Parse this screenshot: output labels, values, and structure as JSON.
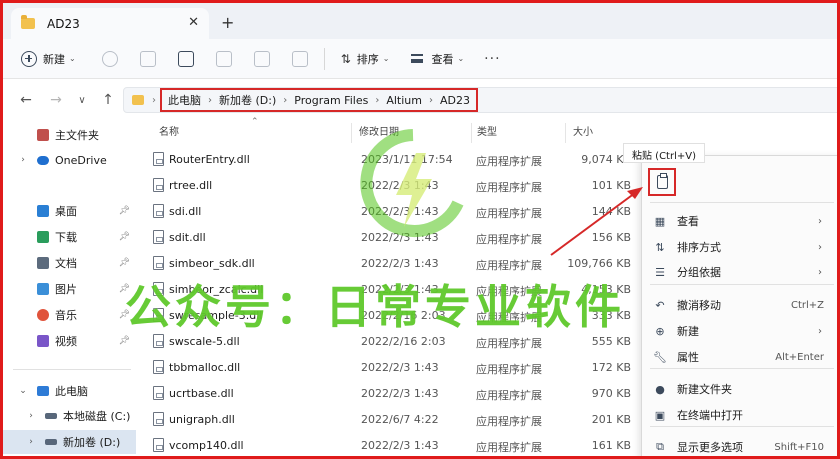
{
  "window": {
    "tab_title": "AD23",
    "tab_close": "✕",
    "new_tab": "+"
  },
  "toolbar": {
    "new_label": "新建",
    "sort_label": "排序",
    "view_label": "查看",
    "more": "···"
  },
  "navigation": {
    "back": "←",
    "forward": "→",
    "recent": "∨",
    "up": "↑",
    "breadcrumbs": [
      "此电脑",
      "新加卷 (D:)",
      "Program Files",
      "Altium",
      "AD23"
    ]
  },
  "sidebar": {
    "items": [
      {
        "label": "主文件夹",
        "icon": "home-icon",
        "color": "#c0504d"
      },
      {
        "label": "OneDrive",
        "icon": "cloud-icon",
        "color": "#1f6fcf"
      },
      {
        "label": "桌面",
        "icon": "desktop-icon",
        "color": "#2a7fd4"
      },
      {
        "label": "下载",
        "icon": "download-icon",
        "color": "#2a9d5c"
      },
      {
        "label": "文档",
        "icon": "document-icon",
        "color": "#5c6b7d"
      },
      {
        "label": "图片",
        "icon": "pictures-icon",
        "color": "#3b8fd8"
      },
      {
        "label": "音乐",
        "icon": "music-icon",
        "color": "#e0533b"
      },
      {
        "label": "视频",
        "icon": "video-icon",
        "color": "#7a56c8"
      },
      {
        "label": "此电脑",
        "icon": "computer-icon",
        "color": "#2e7bd6"
      },
      {
        "label": "本地磁盘 (C:)",
        "icon": "drive-icon",
        "color": "#58677a"
      },
      {
        "label": "新加卷 (D:)",
        "icon": "drive-icon",
        "color": "#58677a"
      }
    ]
  },
  "columns": {
    "name": "名称",
    "modified": "修改日期",
    "type": "类型",
    "size": "大小"
  },
  "files": [
    {
      "name": "RouterEntry.dll",
      "modified": "2023/1/11 17:54",
      "type": "应用程序扩展",
      "size": "9,074 KB"
    },
    {
      "name": "rtree.dll",
      "modified": "2022/2/3 1:43",
      "type": "应用程序扩展",
      "size": "101 KB"
    },
    {
      "name": "sdi.dll",
      "modified": "2022/2/3 1:43",
      "type": "应用程序扩展",
      "size": "144 KB"
    },
    {
      "name": "sdit.dll",
      "modified": "2022/2/3 1:43",
      "type": "应用程序扩展",
      "size": "156 KB"
    },
    {
      "name": "simbeor_sdk.dll",
      "modified": "2022/2/3 1:43",
      "type": "应用程序扩展",
      "size": "109,766 KB"
    },
    {
      "name": "simbeor_zcalc.dll",
      "modified": "2022/2/3 1:43",
      "type": "应用程序扩展",
      "size": "4,153 KB"
    },
    {
      "name": "swresample-3.dll",
      "modified": "2022/2/16 2:03",
      "type": "应用程序扩展",
      "size": "333 KB"
    },
    {
      "name": "swscale-5.dll",
      "modified": "2022/2/16 2:03",
      "type": "应用程序扩展",
      "size": "555 KB"
    },
    {
      "name": "tbbmalloc.dll",
      "modified": "2022/2/3 1:43",
      "type": "应用程序扩展",
      "size": "172 KB"
    },
    {
      "name": "ucrtbase.dll",
      "modified": "2022/2/3 1:43",
      "type": "应用程序扩展",
      "size": "970 KB"
    },
    {
      "name": "unigraph.dll",
      "modified": "2022/6/7 4:22",
      "type": "应用程序扩展",
      "size": "201 KB"
    },
    {
      "name": "vcomp140.dll",
      "modified": "2022/2/3 1:43",
      "type": "应用程序扩展",
      "size": "161 KB"
    }
  ],
  "context_menu": {
    "tooltip": "粘贴 (Ctrl+V)",
    "items": [
      {
        "label": "查看",
        "icon": "grid-icon",
        "shortcut": "",
        "submenu": true
      },
      {
        "label": "排序方式",
        "icon": "sort-icon",
        "shortcut": "",
        "submenu": true
      },
      {
        "label": "分组依据",
        "icon": "group-icon",
        "shortcut": "",
        "submenu": true
      },
      {
        "label": "撤消移动",
        "icon": "undo-icon",
        "shortcut": "Ctrl+Z",
        "submenu": false
      },
      {
        "label": "新建",
        "icon": "new-icon",
        "shortcut": "",
        "submenu": true
      },
      {
        "label": "属性",
        "icon": "wrench-icon",
        "shortcut": "Alt+Enter",
        "submenu": false
      },
      {
        "label": "新建文件夹",
        "icon": "new-folder-icon",
        "shortcut": "",
        "submenu": false
      },
      {
        "label": "在终端中打开",
        "icon": "terminal-icon",
        "shortcut": "",
        "submenu": false
      },
      {
        "label": "显示更多选项",
        "icon": "more-options-icon",
        "shortcut": "Shift+F10",
        "submenu": false
      }
    ],
    "submenu_arrow": "›"
  },
  "watermark": {
    "text": "公众号：日常专业软件"
  },
  "colors": {
    "highlight_red": "#d62828",
    "watermark_green": "#52c41a",
    "selected_bg": "#dbe5f1"
  }
}
